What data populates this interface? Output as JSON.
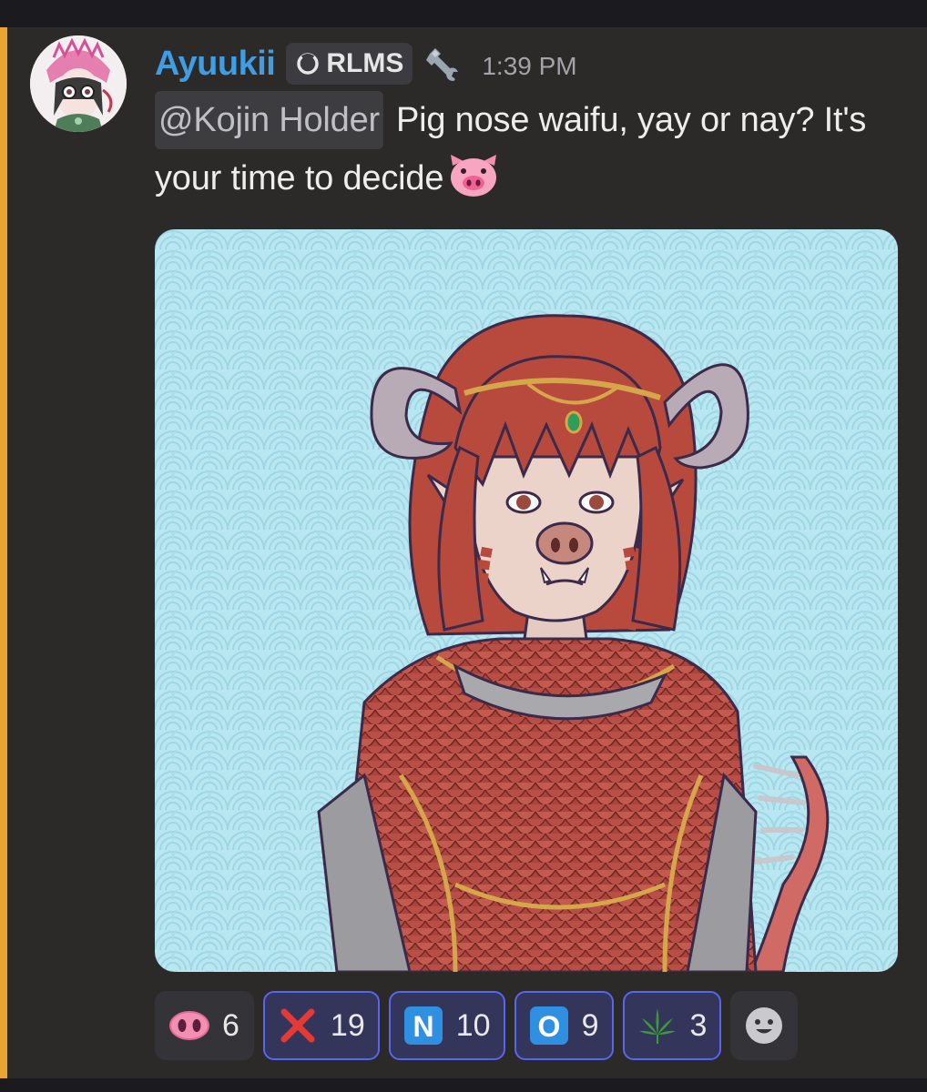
{
  "message": {
    "author": {
      "username": "Ayuukii",
      "tag_label": "RLMS",
      "tag_icon": "guild-tag-icon",
      "badge_icon": "wrench-icon"
    },
    "timestamp": "1:39 PM",
    "mention": "@Kojin Holder",
    "text": "Pig nose waifu, yay or nay? It's your time to decide",
    "text_emoji": "pig-face-emoji",
    "attachment_alt": "",
    "highlight_color": "#e7a532"
  },
  "reactions": [
    {
      "icon": "pig-nose-emoji",
      "count": "6",
      "me": false
    },
    {
      "icon": "cross-mark-emoji",
      "count": "19",
      "me": true
    },
    {
      "icon": "letter-n-emoji",
      "label": "N",
      "count": "10",
      "me": true
    },
    {
      "icon": "letter-o-emoji",
      "label": "O",
      "count": "9",
      "me": true
    },
    {
      "icon": "leaf-emoji",
      "count": "3",
      "me": true
    }
  ],
  "colors": {
    "username": "#3f9de6",
    "background": "#2b2a28",
    "reaction_selected_border": "#5865f2"
  }
}
